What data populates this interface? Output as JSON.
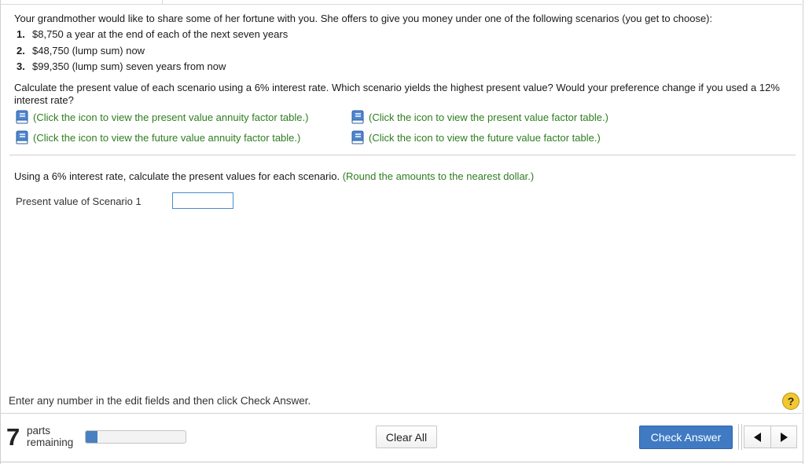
{
  "problem": {
    "intro": "Your grandmother would like to share some of her fortune with you. She offers to give you money under one of the following scenarios (you get to choose):",
    "scenarios": [
      {
        "num": "1.",
        "text": "$8,750 a year at the end of each of the next seven years"
      },
      {
        "num": "2.",
        "text": "$48,750 (lump sum) now"
      },
      {
        "num": "3.",
        "text": "$99,350 (lump sum) seven years from now"
      }
    ],
    "question": "Calculate the present value of each scenario using a 6% interest rate. Which scenario yields the highest present value? Would your preference change if you used a 12% interest rate?"
  },
  "links": {
    "pv_annuity": "(Click the icon to view the present value annuity factor table.)",
    "pv_factor": "(Click the icon to view the present value factor table.)",
    "fv_annuity": "(Click the icon to view the future value annuity factor table.)",
    "fv_factor": "(Click the icon to view the future value factor table.)",
    "icon": "book-icon"
  },
  "part": {
    "instruction": "Using a 6% interest rate, calculate the present values for each scenario.",
    "hint": "(Round the amounts to the nearest dollar.)",
    "field_label": "Present value of Scenario 1",
    "field_value": ""
  },
  "footer": {
    "help_text": "Enter any number in the edit fields and then click Check Answer.",
    "help_icon": "?",
    "parts_count": "7",
    "parts_line1": "parts",
    "parts_line2": "remaining",
    "progress_fraction": 0.12,
    "clear_label": "Clear All",
    "check_label": "Check Answer"
  },
  "colors": {
    "link_green": "#2e7d1f",
    "accent_blue": "#3f7ac3",
    "help_yellow": "#f2c830"
  }
}
